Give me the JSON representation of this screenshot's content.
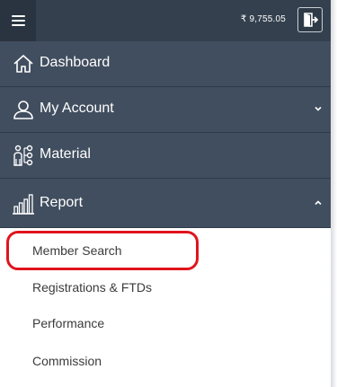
{
  "header": {
    "menu_icon": "hamburger-icon",
    "balance": "₹ 9,755.05",
    "logout_icon": "logout-icon"
  },
  "nav": {
    "items": [
      {
        "label": "Dashboard",
        "icon": "home-icon"
      },
      {
        "label": "My Account",
        "icon": "user-icon",
        "chevron": "chevron-down-icon"
      },
      {
        "label": "Material",
        "icon": "material-icon"
      },
      {
        "label": "Report",
        "icon": "bar-chart-icon",
        "chevron": "chevron-up-icon",
        "expanded": true
      }
    ],
    "report_submenu": [
      {
        "label": "Member Search",
        "highlighted": true
      },
      {
        "label": "Registrations & FTDs"
      },
      {
        "label": "Performance"
      },
      {
        "label": "Commission"
      }
    ]
  },
  "colors": {
    "topbar": "#34404e",
    "menu_bg": "#414e5f",
    "highlight": "#e0141c"
  }
}
